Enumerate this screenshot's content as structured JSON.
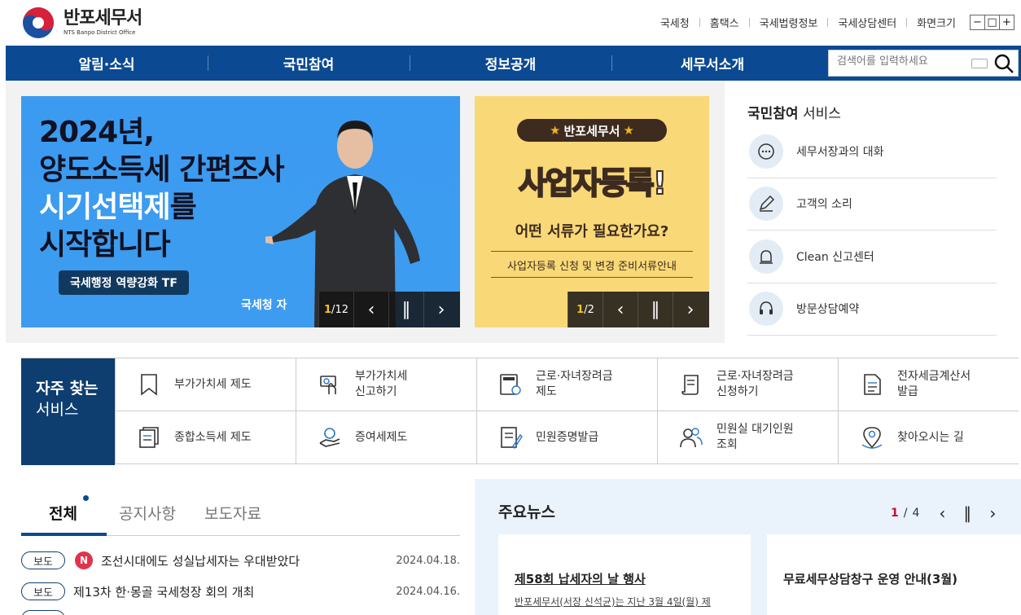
{
  "site": {
    "name": "반포세무서",
    "name_en": "NTS Banpo District Office"
  },
  "util_links": [
    "국세청",
    "홈택스",
    "국세법령정보",
    "국세상담센터",
    "화면크기"
  ],
  "zoom_buttons": [
    "−",
    "□",
    "+"
  ],
  "nav": [
    "알림·소식",
    "국민참여",
    "정보공개",
    "세무서소개"
  ],
  "search": {
    "placeholder": "검색어를 입력하세요"
  },
  "banner1": {
    "line1": "2024년,",
    "line2": "양도소득세 간편조사",
    "line3a": "시기선택제",
    "line3b": "를",
    "line4": "시작합니다",
    "tag": "국세행정 역량강화 TF",
    "footer": "국세청 자",
    "page_current": "1",
    "page_total": "12"
  },
  "banner2": {
    "badge": "반포세무서",
    "title": "사업자등록!",
    "question": "어떤 서류가 필요한가요?",
    "sub": "사업자등록 신청 및 변경 준비서류안내",
    "page_current": "1",
    "page_total": "2"
  },
  "service": {
    "title_bold": "국민참여",
    "title_rest": " 서비스",
    "items": [
      {
        "label": "세무서장과의 대화",
        "icon": "chat-icon"
      },
      {
        "label": "고객의 소리",
        "icon": "pencil-icon"
      },
      {
        "label": "Clean 신고센터",
        "icon": "siren-icon"
      },
      {
        "label": "방문상담예약",
        "icon": "headset-icon"
      }
    ]
  },
  "frequent": {
    "title_bold": "자주 찾는",
    "title_rest": "서비스",
    "items": [
      {
        "line1": "부가가치세 제도",
        "line2": "",
        "icon": "bookmark-icon"
      },
      {
        "line1": "부가가치세",
        "line2": "신고하기",
        "icon": "card-hand-icon"
      },
      {
        "line1": "근로·자녀장려금",
        "line2": "제도",
        "icon": "calculator-icon"
      },
      {
        "line1": "근로·자녀장려금",
        "line2": "신청하기",
        "icon": "scroll-icon"
      },
      {
        "line1": "전자세금계산서",
        "line2": "발급",
        "icon": "document-icon"
      },
      {
        "line1": "종합소득세 제도",
        "line2": "",
        "icon": "documents-icon"
      },
      {
        "line1": "증여세제도",
        "line2": "",
        "icon": "gift-hand-icon"
      },
      {
        "line1": "민원증명발급",
        "line2": "",
        "icon": "certificate-icon"
      },
      {
        "line1": "민원실 대기인원",
        "line2": "조회",
        "icon": "people-icon"
      },
      {
        "line1": "찾아오시는 길",
        "line2": "",
        "icon": "location-icon"
      }
    ]
  },
  "tabs": [
    "전체",
    "공지사항",
    "보도자료"
  ],
  "notices": [
    {
      "type": "보도",
      "new": "N",
      "title": "조선시대에도 성실납세자는 우대받았다",
      "date": "2024.04.18."
    },
    {
      "type": "보도",
      "new": "",
      "title": "제13차 한·몽골 국세청장 회의 개최",
      "date": "2024.04.16."
    }
  ],
  "news": {
    "title": "주요뉴스",
    "page_current": "1",
    "page_total": "4",
    "cards": [
      {
        "title": "제58회 납세자의 날 행사",
        "desc": "반포세무서(서장 신석균)는 지난 3월 4일(월) 제"
      },
      {
        "title": "무료세무상담창구 운영 안내(3월)",
        "desc": ""
      }
    ]
  },
  "colors": {
    "nav": "#0b4a92",
    "freq_head": "#0e3d70",
    "news_bg": "#eaf2fb",
    "banner1": "#3b9bf0",
    "banner2": "#f9d877"
  }
}
